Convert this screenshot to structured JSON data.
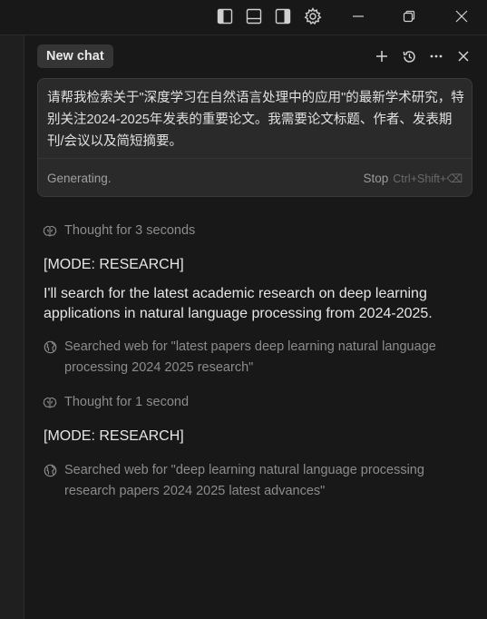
{
  "window": {
    "icons": [
      "toggle-left-sidebar-icon",
      "toggle-bottom-panel-icon",
      "toggle-right-sidebar-icon",
      "settings-icon"
    ],
    "controls": [
      "minimize-icon",
      "restore-icon",
      "close-icon"
    ]
  },
  "chat": {
    "tab_label": "New chat",
    "header_actions": [
      "plus-icon",
      "history-icon",
      "more-icon",
      "close-icon"
    ],
    "input": {
      "text": "请帮我检索关于\"深度学习在自然语言处理中的应用\"的最新学术研究，特别关注2024-2025年发表的重要论文。我需要论文标题、作者、发表期刊/会议以及简短摘要。",
      "status": "Generating.",
      "stop_label": "Stop",
      "stop_shortcut": "Ctrl+Shift+⌫"
    },
    "messages": {
      "thought1": "Thought for 3 seconds",
      "mode1": "[MODE: RESEARCH]",
      "reply1": "I'll search for the latest academic research on deep learning applications in natural language processing from 2024-2025.",
      "search1": "Searched web for \"latest papers deep learning natural language processing 2024 2025 research\"",
      "thought2": "Thought for 1 second",
      "mode2": "[MODE: RESEARCH]",
      "search2": "Searched web for \"deep learning natural language processing research papers 2024 2025 latest advances\""
    }
  },
  "colors": {
    "background": "#181818",
    "panel": "#2a2a2a",
    "text": "#e6e6e6",
    "muted": "#8c8c8c"
  }
}
